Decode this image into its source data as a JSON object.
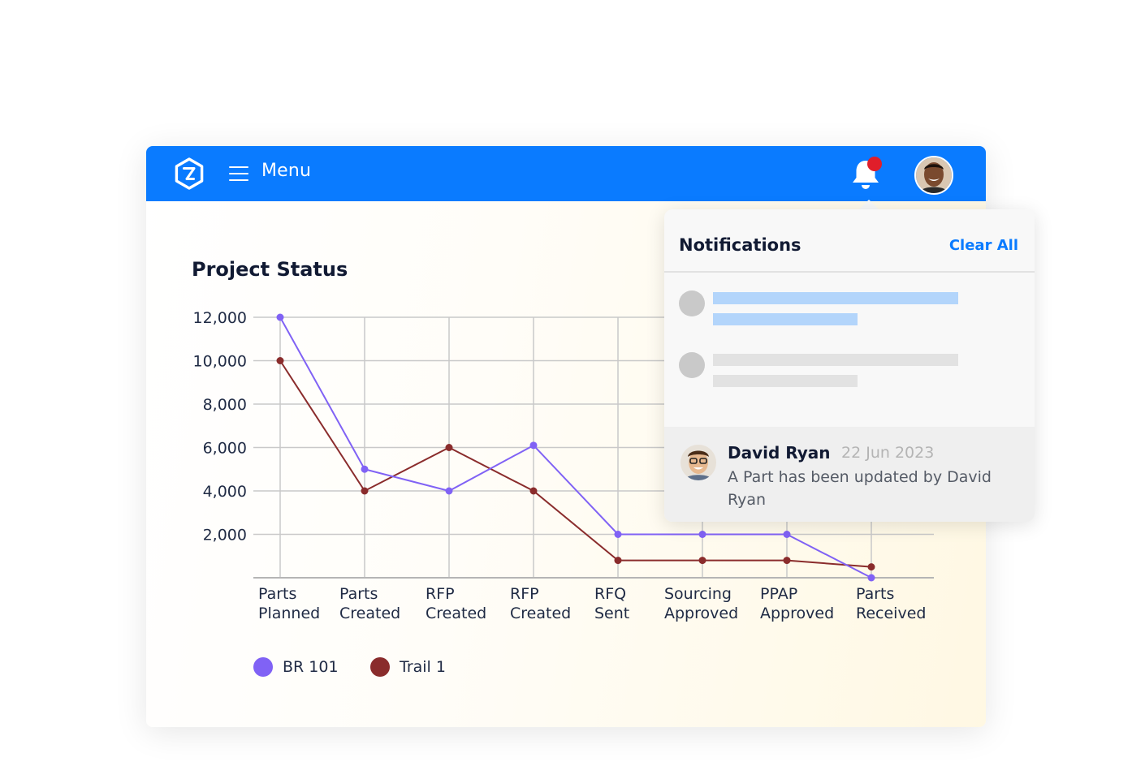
{
  "header": {
    "menu_label": "Menu",
    "brand_color": "#0a7bff",
    "notification_badge_color": "#e01e2a",
    "icons": {
      "logo": "hexagon-logo-icon",
      "menu": "hamburger-icon",
      "notifications": "bell-icon"
    }
  },
  "chart_data": {
    "type": "line",
    "title": "Project Status",
    "categories": [
      "Parts Planned",
      "Parts Created",
      "RFP Created",
      "RFP Created",
      "RFQ Sent",
      "Sourcing Approved",
      "PPAP Approved",
      "Parts Received"
    ],
    "category_lines": [
      [
        "Parts",
        "Planned"
      ],
      [
        "Parts",
        "Created"
      ],
      [
        "RFP",
        "Created"
      ],
      [
        "RFP",
        "Created"
      ],
      [
        "RFQ",
        "Sent"
      ],
      [
        "Sourcing",
        "Approved"
      ],
      [
        "PPAP",
        "Approved"
      ],
      [
        "Parts",
        "Received"
      ]
    ],
    "y_ticks": [
      "2,000",
      "4,000",
      "6,000",
      "8,000",
      "10,000",
      "12,000"
    ],
    "ylim": [
      0,
      12000
    ],
    "grid": true,
    "series": [
      {
        "name": "BR 101",
        "color": "#8062f5",
        "values": [
          12000,
          5000,
          4000,
          6100,
          2000,
          2000,
          2000,
          0
        ]
      },
      {
        "name": "Trail 1",
        "color": "#8a2c2c",
        "values": [
          10000,
          4000,
          6000,
          4000,
          800,
          800,
          800,
          500
        ]
      }
    ],
    "legend_position": "bottom-left"
  },
  "notifications": {
    "title": "Notifications",
    "clear_all": "Clear All",
    "item": {
      "name": "David Ryan",
      "date": "22 Jun 2023",
      "message": "A Part has been updated by David Ryan"
    }
  }
}
